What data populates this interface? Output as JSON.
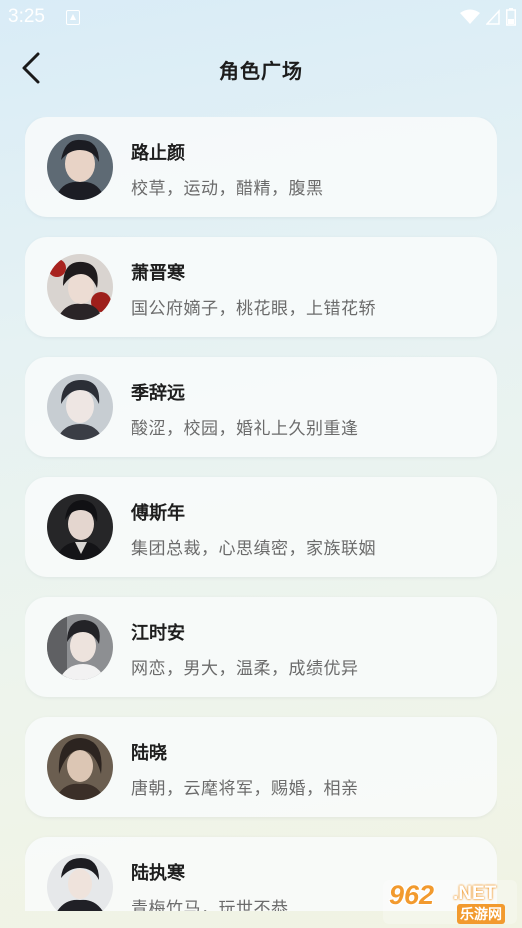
{
  "status_bar": {
    "time": "3:25"
  },
  "header": {
    "title": "角色广场"
  },
  "characters": [
    {
      "name": "路止颜",
      "tags": "校草，运动，醋精，腹黑"
    },
    {
      "name": "萧晋寒",
      "tags": "国公府嫡子，桃花眼，上错花轿"
    },
    {
      "name": "季辞远",
      "tags": "酸涩，校园，婚礼上久别重逢"
    },
    {
      "name": "傅斯年",
      "tags": "集团总裁，心思缜密，家族联姻"
    },
    {
      "name": "江时安",
      "tags": "网恋，男大，温柔，成绩优异"
    },
    {
      "name": "陆晓",
      "tags": "唐朝，云麾将军，赐婚，相亲"
    },
    {
      "name": "陆执寒",
      "tags": "青梅竹马，玩世不恭"
    }
  ],
  "watermark": {
    "number": "962",
    "suffix": ".NET",
    "site": "乐游网"
  },
  "colors": {
    "card_background": "#f8fbfa",
    "title_text": "#1c1c1c",
    "tag_text": "#6b6b6b",
    "watermark_orange": "#f29a2e"
  }
}
